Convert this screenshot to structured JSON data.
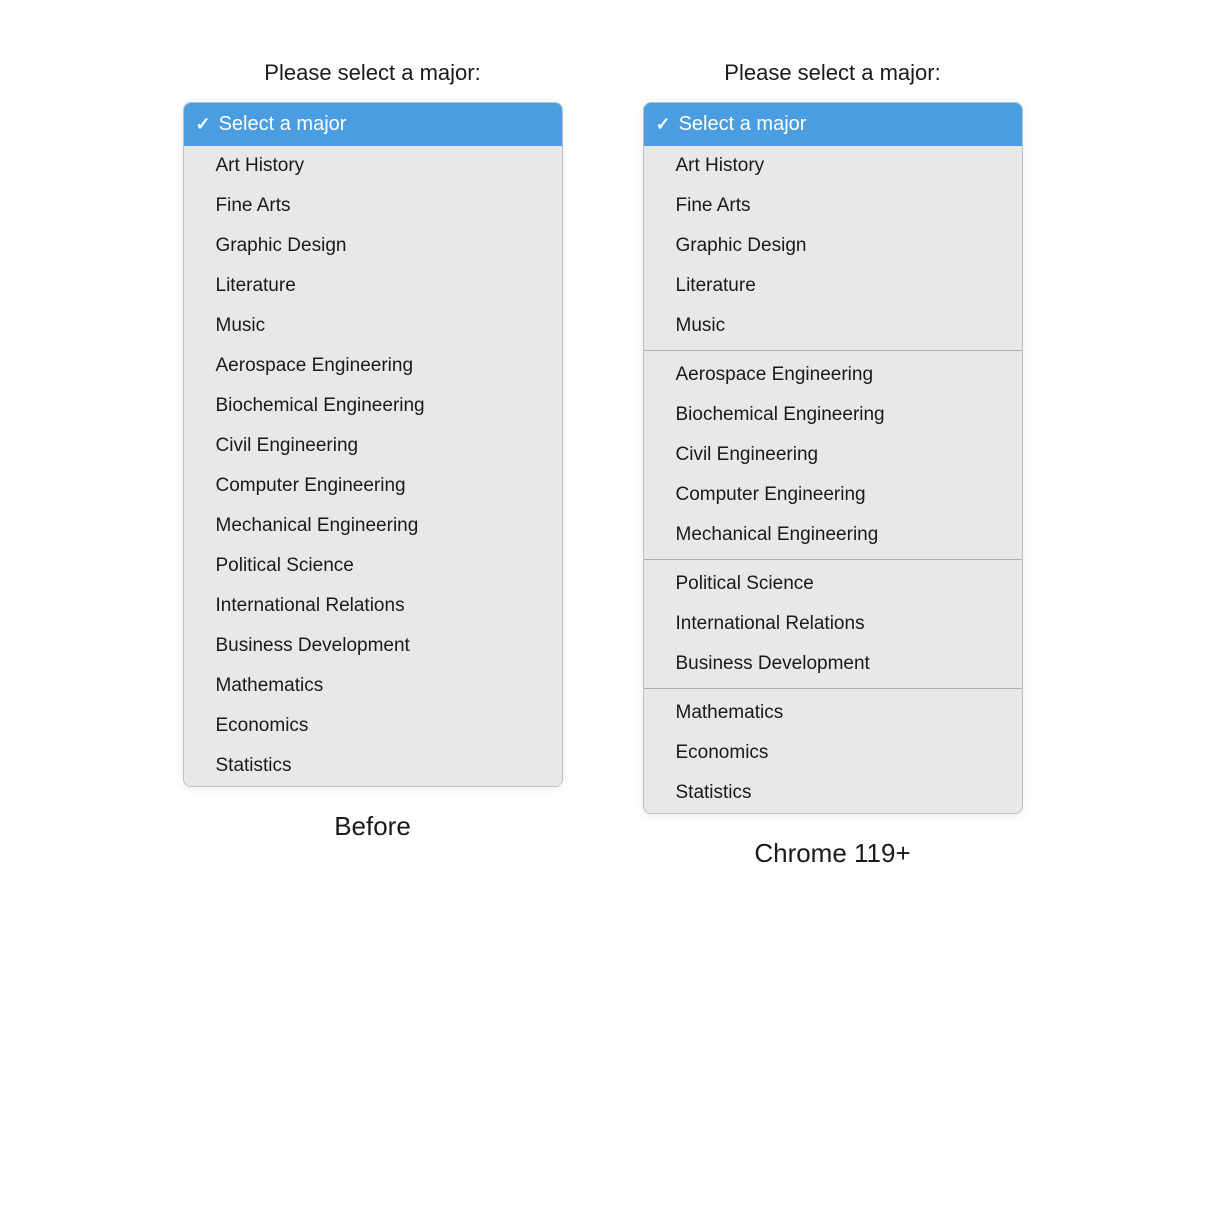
{
  "left_panel": {
    "title": "Please select a major:",
    "caption": "Before",
    "selected": "Select a major",
    "options": [
      "Art History",
      "Fine Arts",
      "Graphic Design",
      "Literature",
      "Music",
      "Aerospace Engineering",
      "Biochemical Engineering",
      "Civil Engineering",
      "Computer Engineering",
      "Mechanical Engineering",
      "Political Science",
      "International Relations",
      "Business Development",
      "Mathematics",
      "Economics",
      "Statistics"
    ]
  },
  "right_panel": {
    "title": "Please select a major:",
    "caption": "Chrome 119+",
    "selected": "Select a major",
    "groups": [
      {
        "items": [
          "Art History",
          "Fine Arts",
          "Graphic Design",
          "Literature",
          "Music"
        ]
      },
      {
        "items": [
          "Aerospace Engineering",
          "Biochemical Engineering",
          "Civil Engineering",
          "Computer Engineering",
          "Mechanical Engineering"
        ]
      },
      {
        "items": [
          "Political Science",
          "International Relations",
          "Business Development"
        ]
      },
      {
        "items": [
          "Mathematics",
          "Economics",
          "Statistics"
        ]
      }
    ]
  },
  "icons": {
    "checkmark": "✓"
  }
}
